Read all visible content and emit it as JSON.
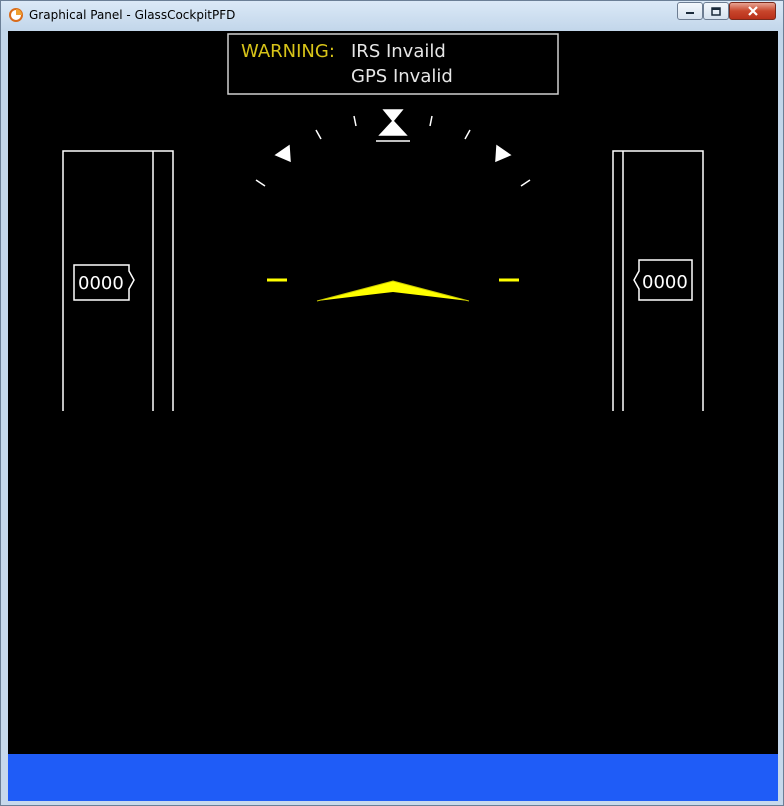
{
  "window": {
    "title": "Graphical Panel - GlassCockpitPFD",
    "buttons": {
      "minimize": "minimize-icon",
      "maximize": "maximize-icon",
      "close": "close-icon"
    }
  },
  "warning": {
    "label": "WARNING:",
    "messages": [
      "IRS Invaild",
      "GPS Invalid"
    ]
  },
  "speed_tape": {
    "readout": "0000"
  },
  "altitude_tape": {
    "readout": "0000"
  },
  "colors": {
    "warning": "#d8c419",
    "aircraft_symbol": "#ffff00",
    "text": "#e6e6e6",
    "status_bar": "#1f5cf7",
    "background": "#000000"
  }
}
